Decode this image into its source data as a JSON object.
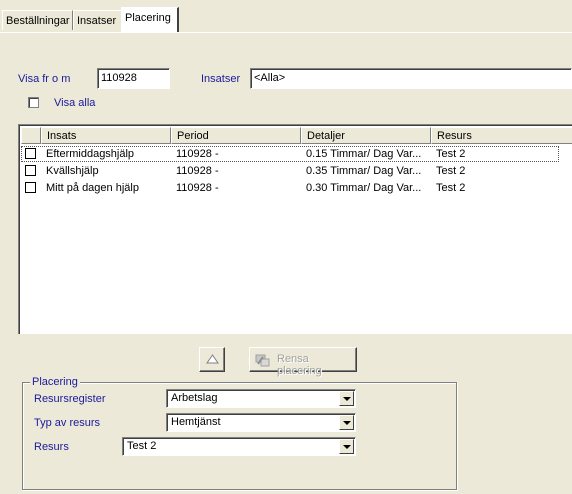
{
  "tabs": [
    {
      "label": "Beställningar"
    },
    {
      "label": "Insatser"
    },
    {
      "label": "Placering"
    }
  ],
  "filter": {
    "visa_from_label": "Visa fr o m",
    "visa_from_value": "110928",
    "insatser_label": "Insatser",
    "insatser_value": "<Alla>",
    "visa_alla_label": "Visa alla"
  },
  "list": {
    "columns": [
      "Insats",
      "Period",
      "Detaljer",
      "Resurs"
    ],
    "rows": [
      {
        "insats": "Eftermiddagshjälp",
        "period": "110928 -",
        "detaljer": "0.15 Timmar/ Dag  Var...",
        "resurs": "Test 2"
      },
      {
        "insats": "Kvällshjälp",
        "period": "110928 -",
        "detaljer": "0.35 Timmar/ Dag  Var...",
        "resurs": "Test 2"
      },
      {
        "insats": "Mitt på dagen hjälp",
        "period": "110928 -",
        "detaljer": "0.30 Timmar/ Dag  Var...",
        "resurs": "Test 2"
      }
    ]
  },
  "buttons": {
    "rensa_label": "Rensa placering"
  },
  "placering": {
    "group_title": "Placering",
    "resursregister_label": "Resursregister",
    "resursregister_value": "Arbetslag",
    "typ_label": "Typ av resurs",
    "typ_value": "Hemtjänst",
    "resurs_label": "Resurs",
    "resurs_value": "Test 2"
  },
  "colors": {
    "label_blue": "#1a1a9c",
    "window_bg": "#ece9d8"
  }
}
